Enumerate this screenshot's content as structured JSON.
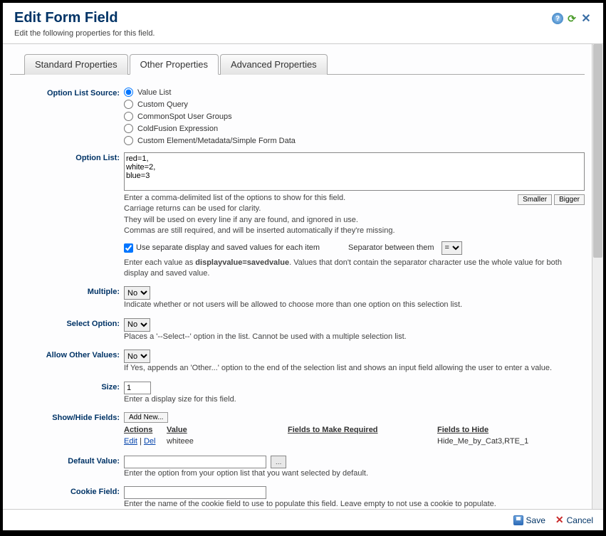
{
  "header": {
    "title": "Edit Form Field",
    "subtitle": "Edit the following properties for this field."
  },
  "tabs": {
    "standard": "Standard Properties",
    "other": "Other Properties",
    "advanced": "Advanced Properties"
  },
  "labels": {
    "option_list_source": "Option List Source:",
    "option_list": "Option List:",
    "multiple": "Multiple:",
    "select_option": "Select Option:",
    "allow_other": "Allow Other Values:",
    "size": "Size:",
    "show_hide": "Show/Hide Fields:",
    "default_value": "Default Value:",
    "cookie_field": "Cookie Field:"
  },
  "option_source": {
    "value_list": "Value List",
    "custom_query": "Custom Query",
    "user_groups": "CommonSpot User Groups",
    "coldfusion": "ColdFusion Expression",
    "custom_element": "Custom Element/Metadata/Simple Form Data"
  },
  "option_list": {
    "value": "red=1,\nwhite=2,\nblue=3",
    "help1": "Enter a comma-delimited list of the options to show for this field.",
    "help2": "Carriage returns can be used for clarity.",
    "help3": "They will be used on every line if any are found, and ignored in use.",
    "help4": "Commas are still required, and will be inserted automatically if they're missing.",
    "smaller": "Smaller",
    "bigger": "Bigger",
    "cb_label": "Use separate display and saved values for each item",
    "sep_label": "Separator between them",
    "sep_value": "=",
    "help5_pre": "Enter each value as ",
    "help5_bold": "displayvalue=savedvalue",
    "help5_post": ". Values that don't contain the separator character use the whole value for both display and saved value."
  },
  "multiple": {
    "value": "No",
    "help": "Indicate whether or not users will be allowed to choose more than one option on this selection list."
  },
  "select_option": {
    "value": "No",
    "help": "Places a '--Select--' option in the list. Cannot be used with a multiple selection list."
  },
  "allow_other": {
    "value": "No",
    "help": "If Yes, appends an 'Other...' option to the end of the selection list and shows an input field allowing the user to enter a value."
  },
  "size": {
    "value": "1",
    "help": "Enter a display size for this field."
  },
  "show_hide": {
    "add_new": "Add New...",
    "col_actions": "Actions",
    "col_value": "Value",
    "col_req": "Fields to Make Required",
    "col_hide": "Fields to Hide",
    "row": {
      "edit": "Edit",
      "del": "Del",
      "value": "whiteee",
      "req": "",
      "hide": "Hide_Me_by_Cat3,RTE_1"
    }
  },
  "default_value": {
    "value": "",
    "help": "Enter the option from your option list that you want selected by default."
  },
  "cookie_field": {
    "value": "",
    "help": "Enter the name of the cookie field to use to populate this field. Leave empty to not use a cookie to populate."
  },
  "footer": {
    "save": "Save",
    "cancel": "Cancel"
  }
}
